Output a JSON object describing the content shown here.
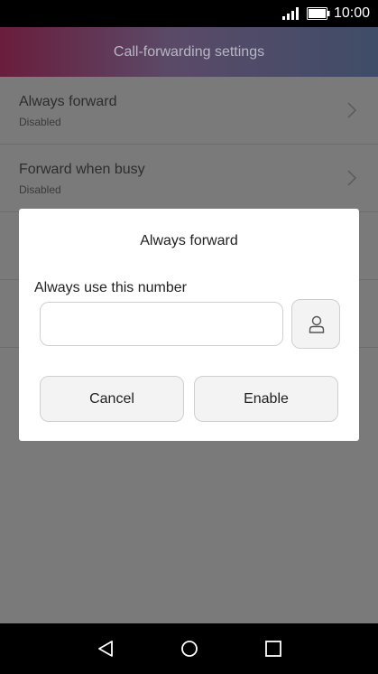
{
  "status_bar": {
    "time": "10:00",
    "icons": [
      "signal-icon",
      "battery-icon"
    ]
  },
  "header": {
    "title": "Call-forwarding settings"
  },
  "list": {
    "items": [
      {
        "label": "Always forward",
        "sub": "Disabled"
      },
      {
        "label": "Forward when busy",
        "sub": "Disabled"
      }
    ]
  },
  "dialog": {
    "title": "Always forward",
    "field_label": "Always use this number",
    "input_value": "",
    "input_placeholder": "",
    "contact_icon": "person-icon",
    "cancel_label": "Cancel",
    "enable_label": "Enable"
  },
  "nav": {
    "icons": [
      "back-icon",
      "home-icon",
      "recents-icon"
    ]
  },
  "colors": {
    "header_gradient_start": "#6a1d3c",
    "header_gradient_end": "#3f4d68",
    "overlay": "#7a7a7a",
    "dialog_bg": "#ffffff",
    "button_bg": "#f3f3f3"
  }
}
